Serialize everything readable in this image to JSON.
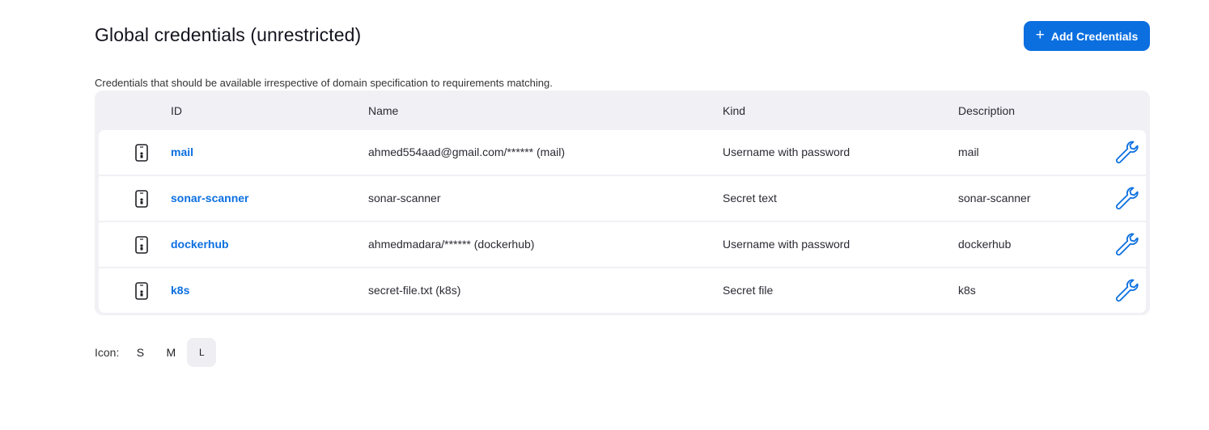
{
  "page": {
    "title": "Global credentials (unrestricted)",
    "description": "Credentials that should be available irrespective of domain specification to requirements matching."
  },
  "toolbar": {
    "add_label": "Add Credentials",
    "add_icon": "plus-icon"
  },
  "table": {
    "columns": [
      "ID",
      "Name",
      "Kind",
      "Description"
    ],
    "rows": [
      {
        "id": "mail",
        "name": "ahmed554aad@gmail.com/****** (mail)",
        "kind": "Username with password",
        "description": "mail"
      },
      {
        "id": "sonar-scanner",
        "name": "sonar-scanner",
        "kind": "Secret text",
        "description": "sonar-scanner"
      },
      {
        "id": "dockerhub",
        "name": "ahmedmadara/****** (dockerhub)",
        "kind": "Username with password",
        "description": "dockerhub"
      },
      {
        "id": "k8s",
        "name": "secret-file.txt (k8s)",
        "kind": "Secret file",
        "description": "k8s"
      }
    ]
  },
  "icon_size": {
    "label": "Icon:",
    "options": [
      "S",
      "M",
      "L"
    ],
    "selected": "L"
  },
  "colors": {
    "accent": "#0b6fe0",
    "table_bg": "#f1f1f5"
  }
}
